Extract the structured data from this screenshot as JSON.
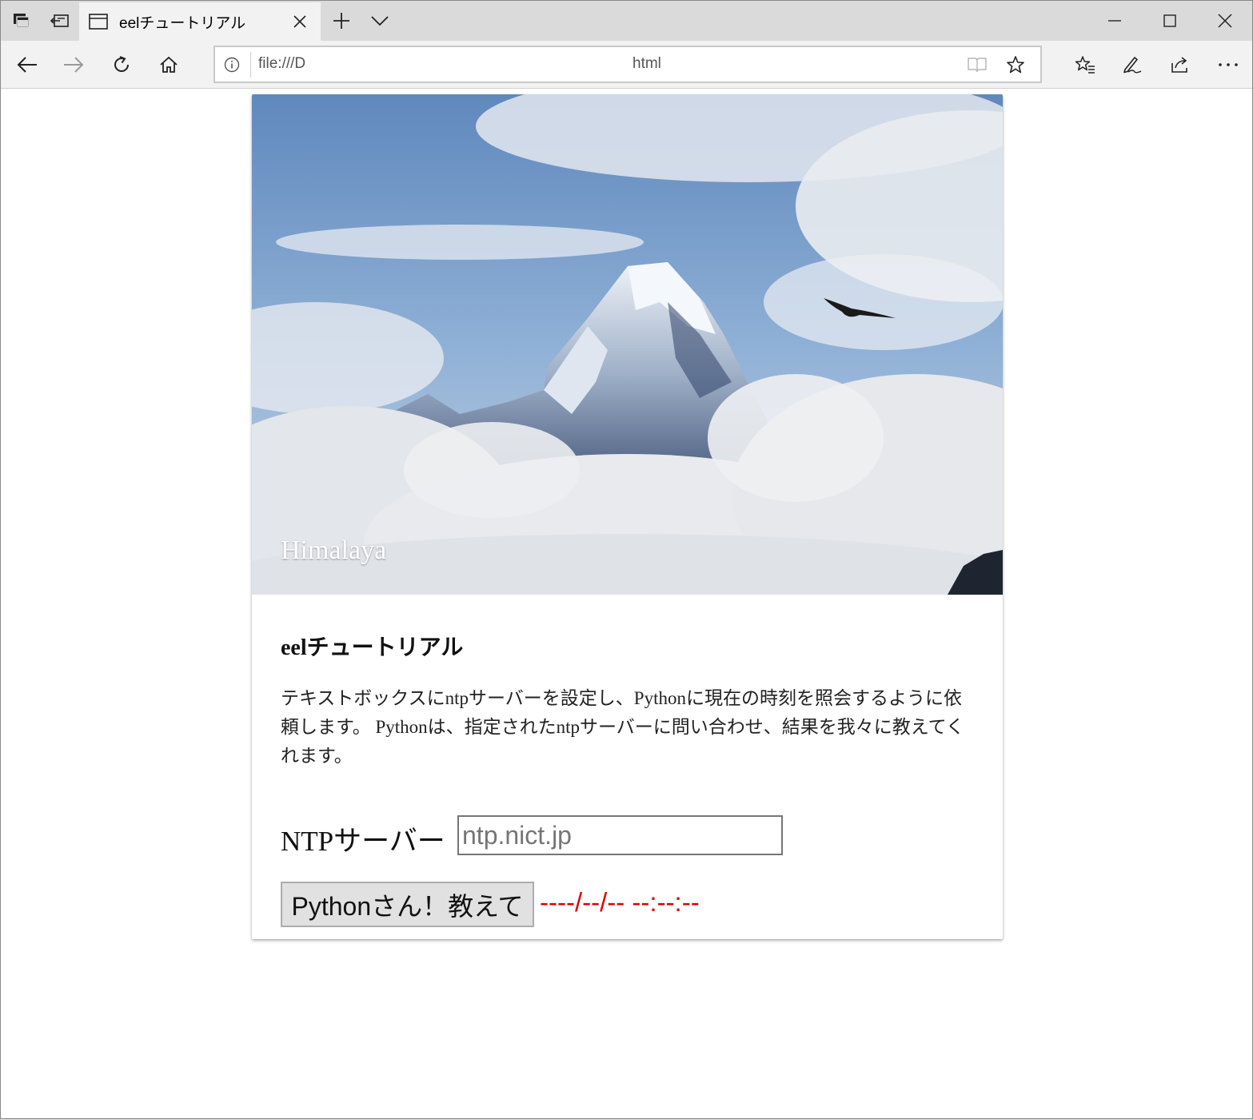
{
  "browser": {
    "tab_title": "eelチュートリアル",
    "address_left": "file:///D",
    "address_right": "html"
  },
  "hero": {
    "caption": "Himalaya"
  },
  "card": {
    "title": "eelチュートリアル",
    "description": "テキストボックスにntpサーバーを設定し、Pythonに現在の時刻を照会するように依頼します。 Pythonは、指定されたntpサーバーに問い合わせ、結果を我々に教えてくれます。"
  },
  "form": {
    "ntp_label": "NTPサーバー",
    "ntp_placeholder": "ntp.nict.jp",
    "ask_button": "Pythonさん！教えて",
    "result": "----/--/-- --:--:--"
  },
  "colors": {
    "result_text": "#e00000",
    "tabbar": "#dadada",
    "navbar": "#f2f2f2"
  },
  "icons": [
    "tab-manager-icon",
    "tab-aside-icon",
    "page-icon",
    "close-icon",
    "new-tab-icon",
    "chevron-down-icon",
    "minimize-icon",
    "maximize-icon",
    "window-close-icon",
    "back-icon",
    "forward-icon",
    "refresh-icon",
    "home-icon",
    "info-icon",
    "reading-view-icon",
    "favorite-star-icon",
    "favorites-list-icon",
    "pen-icon",
    "share-icon",
    "more-icon"
  ]
}
